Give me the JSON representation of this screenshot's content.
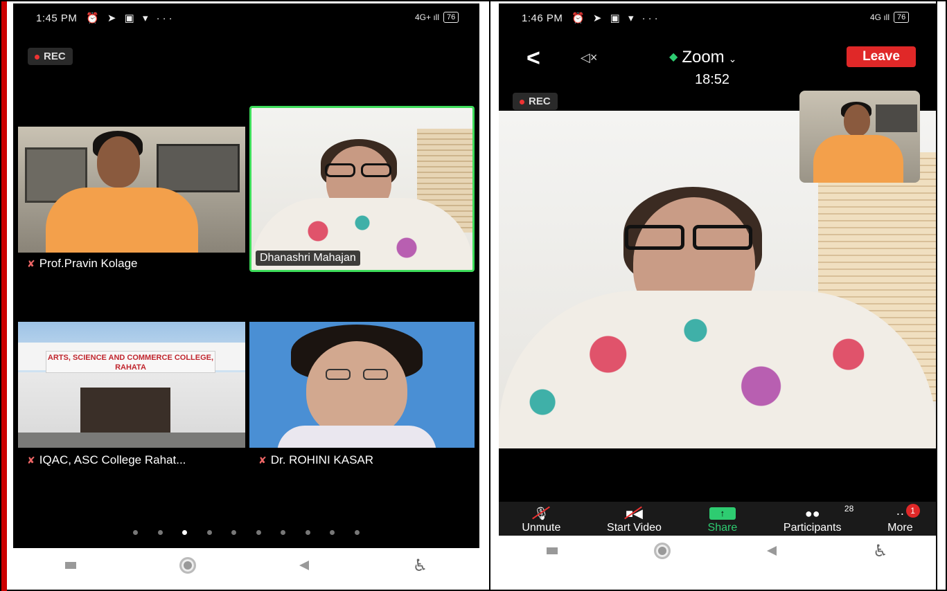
{
  "left_phone": {
    "status_time": "1:45 PM",
    "status_icons": "⏰ ➤ ▣ ▾ ···",
    "signal": "4G+ ıll",
    "battery": "76",
    "rec_label": "REC",
    "participants": [
      {
        "name": "Prof.Pravin Kolage",
        "muted": true
      },
      {
        "name": "Dhanashri Mahajan",
        "active_speaker": true
      },
      {
        "name": "IQAC, ASC College Rahat...",
        "muted": true
      },
      {
        "name": "Dr. ROHINI KASAR",
        "muted": true
      }
    ],
    "college_sign": "ARTS, SCIENCE AND COMMERCE COLLEGE, RAHATA",
    "page_dots_total": 10,
    "page_dots_active": 3
  },
  "right_phone": {
    "status_time": "1:46 PM",
    "status_icons": "⏰ ➤ ▣ ▾ ···",
    "signal": "4G ıll",
    "battery": "76",
    "rec_label": "REC",
    "meeting_title": "Zoom",
    "meeting_timer": "18:52",
    "leave_label": "Leave",
    "toolbar": {
      "unmute": "Unmute",
      "start_video": "Start Video",
      "share": "Share",
      "participants": "Participants",
      "participants_count": "28",
      "more": "More",
      "more_badge": "1"
    }
  },
  "colors": {
    "accent_green": "#2ecc71",
    "leave_red": "#e02828",
    "background": "#000000"
  }
}
